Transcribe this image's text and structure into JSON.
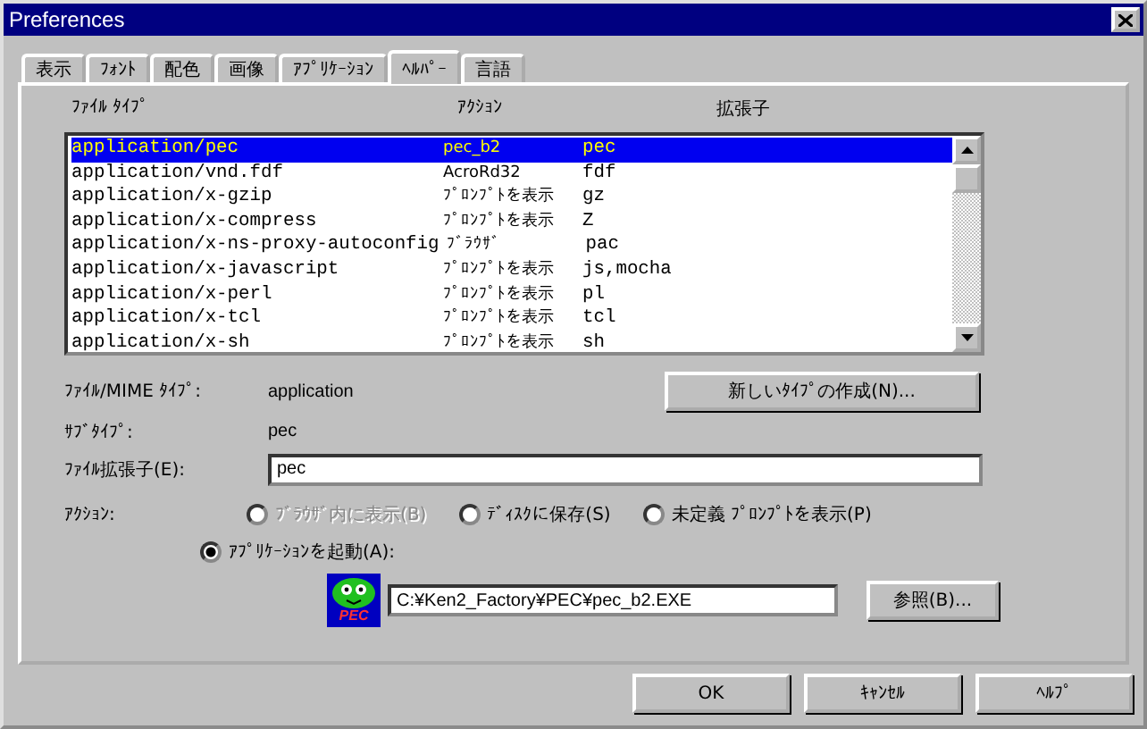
{
  "window": {
    "title": "Preferences"
  },
  "tabs": [
    {
      "label": "表示",
      "selected": false
    },
    {
      "label": "ﾌｫﾝﾄ",
      "selected": false
    },
    {
      "label": "配色",
      "selected": false
    },
    {
      "label": "画像",
      "selected": false
    },
    {
      "label": "ｱﾌﾟﾘｹｰｼｮﾝ",
      "selected": false
    },
    {
      "label": "ﾍﾙﾊﾟｰ",
      "selected": true
    },
    {
      "label": "言語",
      "selected": false
    }
  ],
  "table": {
    "columns": [
      "ﾌｧｲﾙ ﾀｲﾌﾟ",
      "ｱｸｼｮﾝ",
      "拡張子"
    ],
    "rows": [
      {
        "cells": [
          "application/pec",
          "pec_b2",
          "pec"
        ],
        "selected": true
      },
      {
        "cells": [
          "application/vnd.fdf",
          "AcroRd32",
          "fdf"
        ],
        "selected": false
      },
      {
        "cells": [
          "application/x-gzip",
          "ﾌﾟﾛﾝﾌﾟﾄを表示",
          "gz"
        ],
        "selected": false
      },
      {
        "cells": [
          "application/x-compress",
          "ﾌﾟﾛﾝﾌﾟﾄを表示",
          "Z"
        ],
        "selected": false
      },
      {
        "cells": [
          "application/x-ns-proxy-autoconfig",
          "ﾌﾞﾗｳｻﾞ",
          "pac"
        ],
        "selected": false
      },
      {
        "cells": [
          "application/x-javascript",
          "ﾌﾟﾛﾝﾌﾟﾄを表示",
          "js,mocha"
        ],
        "selected": false
      },
      {
        "cells": [
          "application/x-perl",
          "ﾌﾟﾛﾝﾌﾟﾄを表示",
          "pl"
        ],
        "selected": false
      },
      {
        "cells": [
          "application/x-tcl",
          "ﾌﾟﾛﾝﾌﾟﾄを表示",
          "tcl"
        ],
        "selected": false
      },
      {
        "cells": [
          "application/x-sh",
          "ﾌﾟﾛﾝﾌﾟﾄを表示",
          "sh"
        ],
        "selected": false
      }
    ]
  },
  "mime": {
    "label": "ﾌｧｲﾙ/MIME ﾀｲﾌﾟ:",
    "value": "application",
    "new_button": "新しいﾀｲﾌﾟの作成(N)..."
  },
  "subtype": {
    "label": "ｻﾌﾞﾀｲﾌﾟ:",
    "value": "pec"
  },
  "extension": {
    "label": "ﾌｧｲﾙ拡張子(E):",
    "value": "pec"
  },
  "action": {
    "label": "ｱｸｼｮﾝ:",
    "options": [
      {
        "label": "ﾌﾞﾗｳｻﾞ内に表示(B)",
        "selected": false,
        "disabled": true
      },
      {
        "label": "ﾃﾞｨｽｸに保存(S)",
        "selected": false,
        "disabled": false
      },
      {
        "label": "未定義 ﾌﾟﾛﾝﾌﾟﾄを表示(P)",
        "selected": false,
        "disabled": false
      },
      {
        "label": "ｱﾌﾟﾘｹｰｼｮﾝを起動(A):",
        "selected": true,
        "disabled": false
      }
    ]
  },
  "app": {
    "icon_label": "PEC",
    "path": "C:¥Ken2_Factory¥PEC¥pec_b2.EXE",
    "browse_button": "参照(B)..."
  },
  "buttons": [
    "OK",
    "ｷｬﾝｾﾙ",
    "ﾍﾙﾌﾟ"
  ]
}
